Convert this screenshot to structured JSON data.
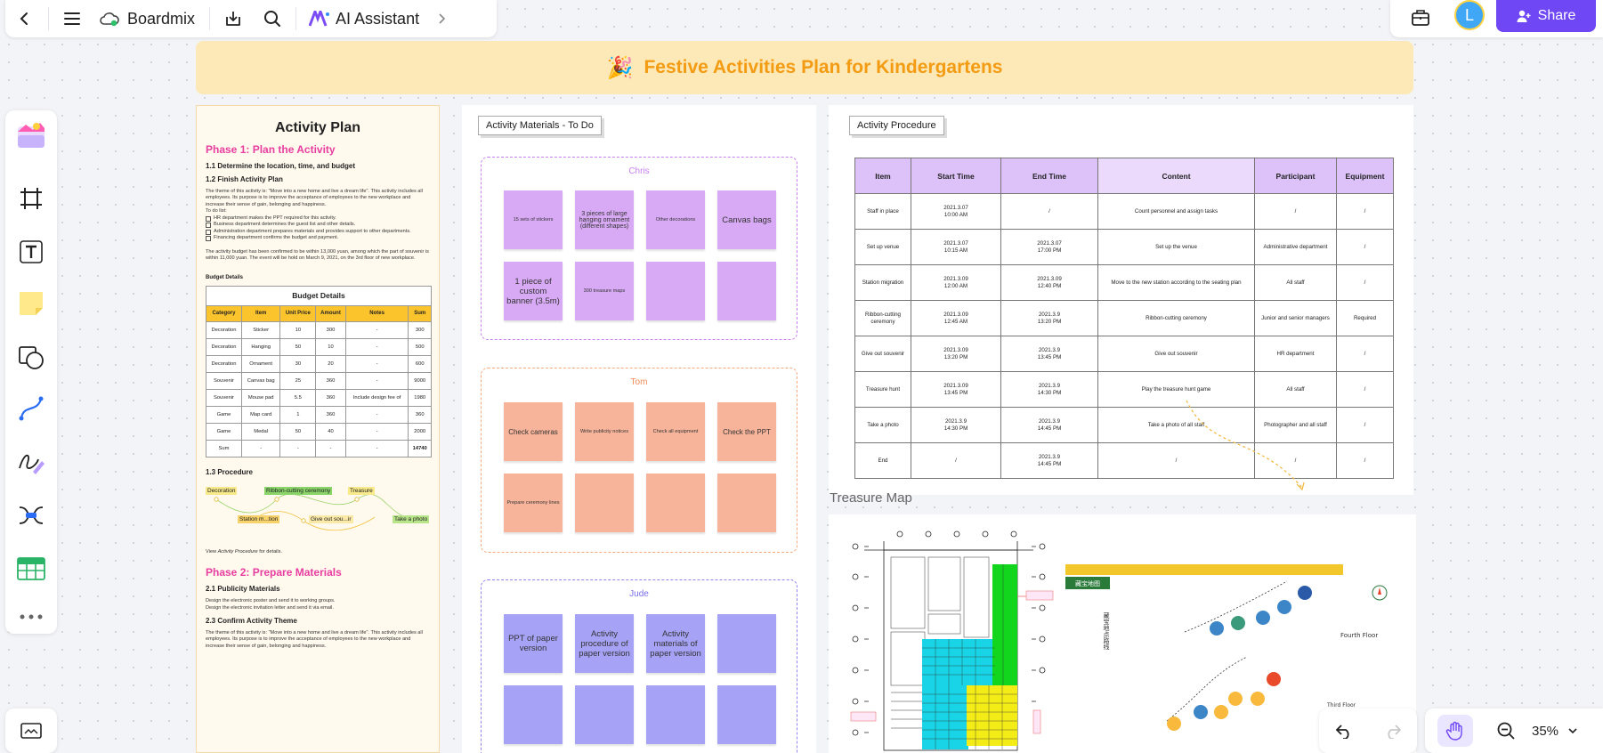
{
  "app": {
    "name": "Boardmix",
    "ai_label": "AI Assistant",
    "share_label": "Share",
    "avatar_initial": "L"
  },
  "colors": {
    "accent": "#6f47f5",
    "banner_bg": "#fde9b7",
    "banner_text": "#f39b12",
    "phase": "#e83ea0"
  },
  "icons": {
    "back": "chevron-left-icon",
    "menu": "menu-icon",
    "cloud": "cloud-sync-icon",
    "download": "download-icon",
    "search": "search-icon",
    "ai": "ai-assistant-icon",
    "expand": "chevron-right-icon",
    "briefcase": "toolbox-icon",
    "share": "user-plus-icon"
  },
  "banner": {
    "emoji": "🎉",
    "title": "Festive Activities Plan for Kindergartens"
  },
  "plan": {
    "title": "Activity Plan",
    "phase1": "Phase 1: Plan the Activity",
    "s11": "1.1 Determine the location, time, and budget",
    "s12": "1.2 Finish Activity Plan",
    "intro": "The theme of this activity is: \"Move into a new home and live a dream life\". This activity includes all employees. Its purpose is to improve the acceptance of employees to the new workplace and increase their sense of gain, belonging and happiness.",
    "todo_label": "To do list:",
    "todos": [
      "HR department makes the PPT required for this activity.",
      "Business department determines the guest list and other details.",
      "Administration department prepares materials and provides support to other departments.",
      "Financing department confirms the budget and payment."
    ],
    "budget_note": "The activity budget has been confirmed to be within 13,000 yuan, among which the part of souvenir is within 11,000 yuan. The event will be hold on March 9, 2021, on the 3rd floor of new workplace.",
    "budget_label": "Budget Details",
    "budget_caption": "Budget Details",
    "budget_headers": [
      "Category",
      "Item",
      "Unit Price",
      "Amount",
      "Notes",
      "Sum"
    ],
    "budget_rows": [
      [
        "Decoration",
        "Sticker",
        "10",
        "300",
        "-",
        "300"
      ],
      [
        "Decoration",
        "Hanging",
        "50",
        "10",
        "-",
        "500"
      ],
      [
        "Decoration",
        "Ornament",
        "30",
        "20",
        "-",
        "600"
      ],
      [
        "Souvenir",
        "Canvas bag",
        "25",
        "360",
        "-",
        "9000"
      ],
      [
        "Souvenir",
        "Mouse pad",
        "5.5",
        "360",
        "Include design fee of",
        "1980"
      ],
      [
        "Game",
        "Map card",
        "1",
        "360",
        "-",
        "360"
      ],
      [
        "Game",
        "Medal",
        "50",
        "40",
        "-",
        "2000"
      ],
      [
        "Sum",
        "-",
        "-",
        "-",
        "-",
        "14740"
      ]
    ],
    "s13": "1.3 Procedure",
    "flow": [
      "Decoration",
      "Ribbon-cutting ceremony",
      "Treasure",
      "Station m...tion",
      "Give out sou...ir",
      "Take a photo"
    ],
    "view_note_pre": "View ",
    "view_note_em": "Activity Procedure",
    "view_note_post": " for details.",
    "phase2": "Phase 2: Prepare Materials",
    "s21": "2.1 Publicity Materials",
    "s21_lines": [
      "Design the electronic poster and send it to working groups.",
      "Design the electronic invitation letter and send it via email."
    ],
    "s23": "2.3 Confirm Activity Theme",
    "theme_text": "The theme of this activity is: \"Move into a new home and live a dream life\". This activity includes all employees. Its purpose is to improve the acceptance of employees to the new workplace and increase their sense of gain, belonging and happiness."
  },
  "materials": {
    "title": "Activity Materials - To Do",
    "chris": {
      "name": "Chris",
      "notes": [
        "15 sets of stickers",
        "3 pieces of large hanging ornament (different shapes)",
        "Other decorations",
        "Canvas bags",
        "1 piece of custom banner (3.5m)",
        "300 treasure maps",
        "",
        ""
      ]
    },
    "tom": {
      "name": "Tom",
      "notes": [
        "Check cameras",
        "Write publicity notices",
        "Check all equipment",
        "Check the PPT",
        "Prepare ceremony lines",
        "",
        "",
        ""
      ]
    },
    "jude": {
      "name": "Jude",
      "notes": [
        "PPT of paper version",
        "Activity procedure of paper version",
        "Activity materials of paper version",
        "",
        "",
        "",
        "",
        ""
      ]
    }
  },
  "procedure": {
    "title": "Activity Procedure",
    "headers": [
      "Item",
      "Start Time",
      "End Time",
      "Content",
      "Participant",
      "Equipment"
    ],
    "rows": [
      [
        "Staff in place",
        "2021.3.07\n10:00 AM",
        "/",
        "Count personnel and assign tasks",
        "/",
        "/"
      ],
      [
        "Set up venue",
        "2021.3.07\n10:15 AM",
        "2021.3.07\n17:00 PM",
        "Set up the venue",
        "Administrative department",
        "/"
      ],
      [
        "Station migration",
        "2021.3.09\n12:00 AM",
        "2021.3.09\n12:40 PM",
        "Move to the new station according to the seating plan",
        "All staff",
        "/"
      ],
      [
        "Ribbon-cutting ceremony",
        "2021.3.09\n12:45 AM",
        "2021.3.9\n13:20 PM",
        "Ribbon-cutting ceremony",
        "Junior and senior managers",
        "Required"
      ],
      [
        "Give out souvenir",
        "2021.3.09\n13:20 PM",
        "2021.3.9\n13:45 PM",
        "Give out souvenir",
        "HR department",
        "/"
      ],
      [
        "Treasure hunt",
        "2021.3.09\n13:45 PM",
        "2021.3.9\n14:30 PM",
        "Play the treasure hunt game",
        "All staff",
        "/"
      ],
      [
        "Take a photo",
        "2021.3.9\n14:30 PM",
        "2021.3.9\n14:45 PM",
        "Take a photo of all staff",
        "Photographer and all staff",
        "/"
      ],
      [
        "End",
        "/",
        "2021.3.9\n14:45 PM",
        "/",
        "/",
        "/"
      ]
    ]
  },
  "treasure_map": {
    "label": "Treasure Map",
    "fourth_floor": "Fourth Floor",
    "third_floor": "Third Floor",
    "map_title": "藏宝地图",
    "side_title": "藏宝地点路线"
  },
  "zoom": {
    "level": "35%"
  }
}
